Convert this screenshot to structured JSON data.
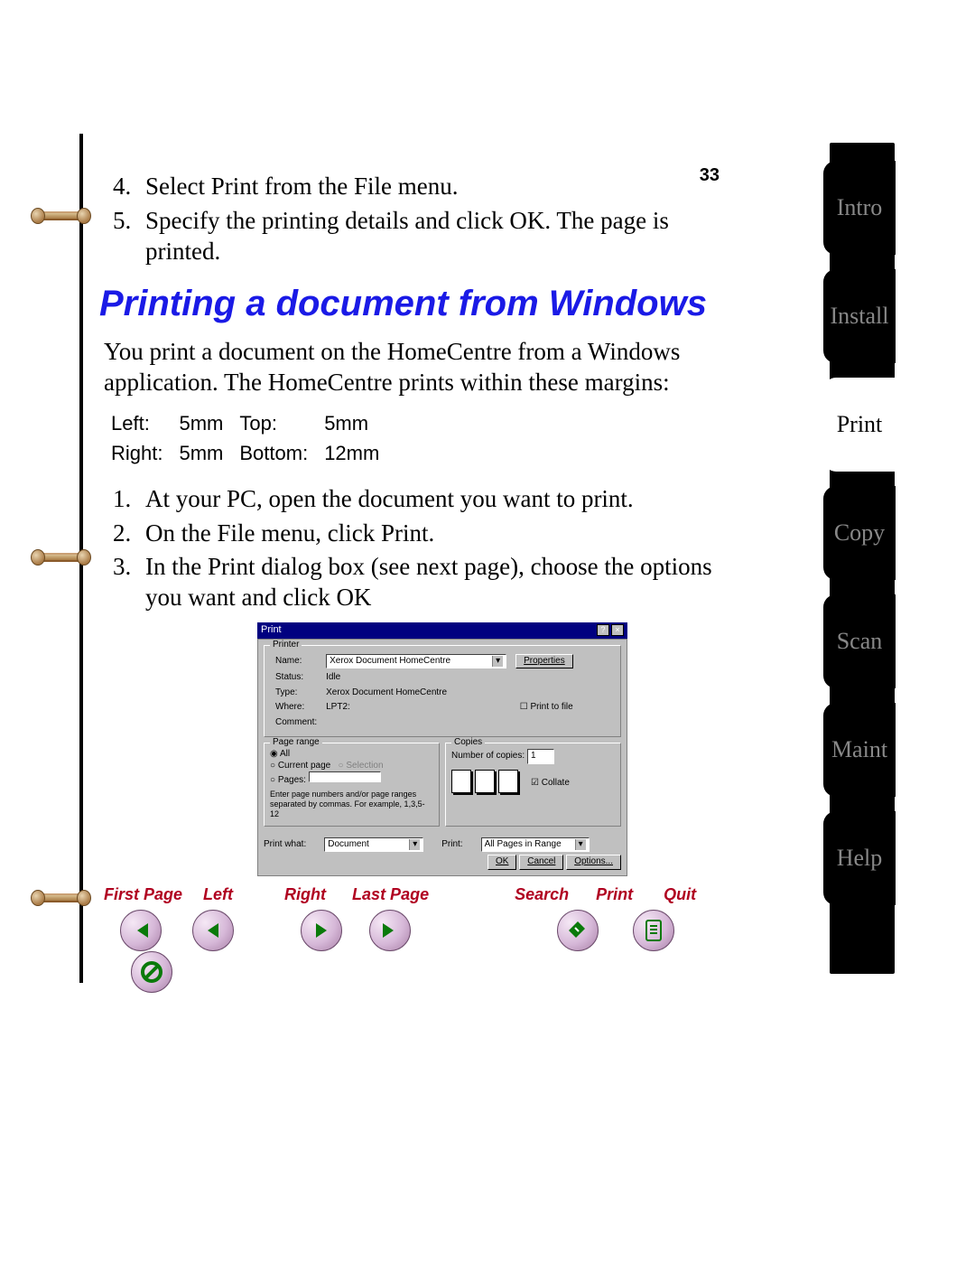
{
  "page_number": "33",
  "steps_top": [
    {
      "n": "4.",
      "text": "Select Print from the File menu."
    },
    {
      "n": "5.",
      "text": "Specify the printing details and click OK. The page is printed."
    }
  ],
  "section_title": "Printing a document from Windows",
  "intro_para": "You print a document on the HomeCentre from a Windows application. The HomeCentre prints within these margins:",
  "margins": {
    "left_label": "Left:",
    "left_val": "5mm",
    "top_label": "Top:",
    "top_val": "5mm",
    "right_label": "Right:",
    "right_val": "5mm",
    "bottom_label": "Bottom:",
    "bottom_val": "12mm"
  },
  "steps_bottom": [
    {
      "n": "1.",
      "text": "At your PC, open the document you want to print."
    },
    {
      "n": "2.",
      "text": "On the File menu, click Print."
    },
    {
      "n": "3.",
      "text": "In the Print dialog box (see next page), choose the options you want and click OK"
    }
  ],
  "dialog": {
    "title": "Print",
    "printer_legend": "Printer",
    "name_label": "Name:",
    "name_value": "Xerox Document HomeCentre",
    "properties_btn": "Properties",
    "status_label": "Status:",
    "status_value": "Idle",
    "type_label": "Type:",
    "type_value": "Xerox Document HomeCentre",
    "where_label": "Where:",
    "where_value": "LPT2:",
    "comment_label": "Comment:",
    "print_to_file": "Print to file",
    "range_legend": "Page range",
    "range_all": "All",
    "range_current": "Current page",
    "range_selection": "Selection",
    "range_pages": "Pages:",
    "range_hint": "Enter page numbers and/or page ranges separated by commas. For example, 1,3,5-12",
    "copies_legend": "Copies",
    "copies_label": "Number of copies:",
    "copies_value": "1",
    "collate": "Collate",
    "printwhat_label": "Print what:",
    "printwhat_value": "Document",
    "print_label": "Print:",
    "print_value": "All Pages in Range",
    "ok_btn": "OK",
    "cancel_btn": "Cancel",
    "options_btn": "Options..."
  },
  "nav": {
    "first": "First Page",
    "left": "Left",
    "right": "Right",
    "last": "Last Page",
    "search": "Search",
    "print": "Print",
    "quit": "Quit"
  },
  "tabs": [
    {
      "label": "Intro",
      "active": false
    },
    {
      "label": "Install",
      "active": false
    },
    {
      "label": "Print",
      "active": true
    },
    {
      "label": "Copy",
      "active": false
    },
    {
      "label": "Scan",
      "active": false
    },
    {
      "label": "Maint",
      "active": false
    },
    {
      "label": "Help",
      "active": false
    }
  ]
}
